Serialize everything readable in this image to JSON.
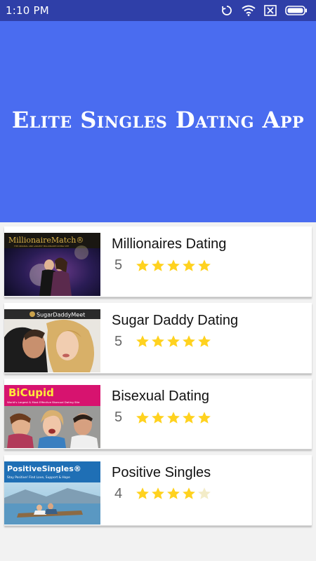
{
  "status_bar": {
    "time": "1:10 PM",
    "icons": [
      "sync-icon",
      "wifi-icon",
      "no-sim-icon",
      "battery-icon"
    ]
  },
  "header": {
    "title": "Elite Singles Dating App",
    "background_color": "#4a6cf0"
  },
  "apps": [
    {
      "name": "Millionaires Dating",
      "rating": 5,
      "thumb": {
        "logo": "MillionaireMatch®",
        "tagline": "THE ORIGINAL AND LARGEST MILLIONAIRE DATING SITE"
      }
    },
    {
      "name": "Sugar Daddy Dating",
      "rating": 5,
      "thumb": {
        "logo": "SugarDaddyMeet"
      }
    },
    {
      "name": "Bisexual Dating",
      "rating": 5,
      "thumb": {
        "logo": "BiCupid",
        "tagline": "World's Largest & Most Effective Bisexual Dating Site"
      }
    },
    {
      "name": "Positive Singles",
      "rating": 4,
      "thumb": {
        "logo": "PositiveSingles®",
        "tagline": "Stay Positive! Find Love, Support & Hope"
      }
    }
  ],
  "colors": {
    "star_filled": "#ffd21f",
    "star_empty": "#f3ecc8",
    "status_bar": "#2f3fa8"
  }
}
